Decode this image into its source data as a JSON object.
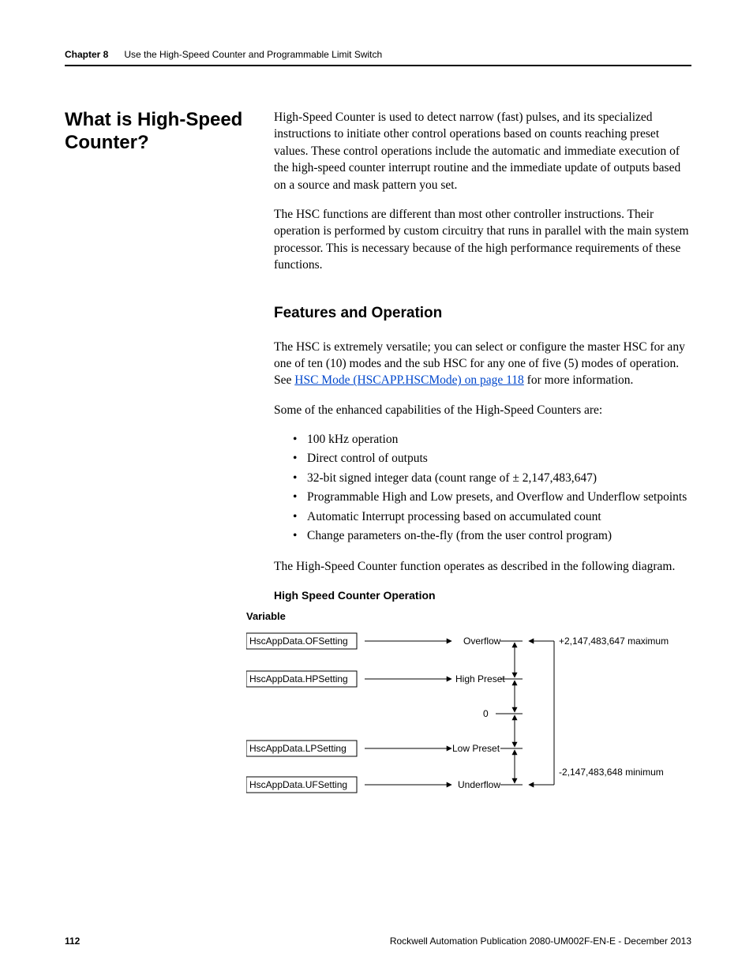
{
  "header": {
    "chapter": "Chapter 8",
    "title": "Use the High-Speed Counter and Programmable Limit Switch"
  },
  "side_heading": "What is High-Speed Counter?",
  "para1": "High-Speed Counter is used to detect narrow (fast) pulses, and its specialized instructions to initiate other control operations based on counts reaching preset values. These control operations include the automatic and immediate execution of the high-speed counter interrupt routine and the immediate update of outputs based on a source and mask pattern you set.",
  "para2": "The HSC functions are different than most other controller instructions. Their operation is performed by custom circuitry that runs in parallel with the main system processor. This is necessary because of the high performance requirements of these functions.",
  "section2_heading": "Features and Operation",
  "para3a": "The HSC is extremely versatile; you can select or configure the master HSC for any one of ten (10) modes and the sub HSC for any one of five (5) modes of operation. See ",
  "para3_link": "HSC Mode (HSCAPP.HSCMode) on page 118",
  "para3b": " for more information.",
  "para4": "Some of the enhanced capabilities of the High-Speed Counters are:",
  "features": [
    "100 kHz operation",
    "Direct control of outputs",
    "32-bit signed integer data (count range of ± 2,147,483,647)",
    "Programmable High and Low presets, and Overflow and Underflow setpoints",
    "Automatic Interrupt processing based on accumulated count",
    "Change parameters on-the-fly (from the user control program)"
  ],
  "para5": "The High-Speed Counter function operates as described in the following diagram.",
  "diagram": {
    "title": "High Speed Counter Operation",
    "var_label": "Variable",
    "rows": [
      {
        "var": "HscAppData.OFSetting",
        "label": "Overflow"
      },
      {
        "var": "HscAppData.HPSetting",
        "label": "High Preset"
      },
      {
        "var": "",
        "label": "0"
      },
      {
        "var": "HscAppData.LPSetting",
        "label": "Low Preset"
      },
      {
        "var": "HscAppData.UFSetting",
        "label": "Underflow"
      }
    ],
    "max_label": "+2,147,483,647 maximum",
    "min_label": "-2,147,483,648 minimum"
  },
  "footer": {
    "page": "112",
    "pub": "Rockwell Automation Publication 2080-UM002F-EN-E - December 2013"
  }
}
